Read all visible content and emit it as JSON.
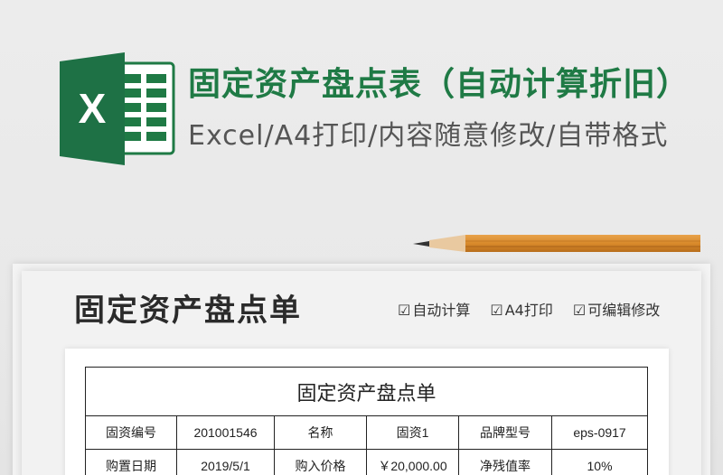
{
  "banner": {
    "title": "固定资产盘点表（自动计算折旧）",
    "subtitle": "Excel/A4打印/内容随意修改/自带格式",
    "logo_letter": "X",
    "brand_color": "#1f7a45"
  },
  "sheet": {
    "title": "固定资产盘点单",
    "features": [
      {
        "check": "☑",
        "label": "自动计算"
      },
      {
        "check": "☑",
        "label": "A4打印"
      },
      {
        "check": "☑",
        "label": "可编辑修改"
      }
    ]
  },
  "form": {
    "caption": "固定资产盘点单",
    "rows": [
      [
        "固资编号",
        "201001546",
        "名称",
        "固资1",
        "品牌型号",
        "eps-0917"
      ],
      [
        "购置日期",
        "2019/5/1",
        "购入价格",
        "￥20,000.00",
        "净残值率",
        "10%"
      ]
    ]
  }
}
